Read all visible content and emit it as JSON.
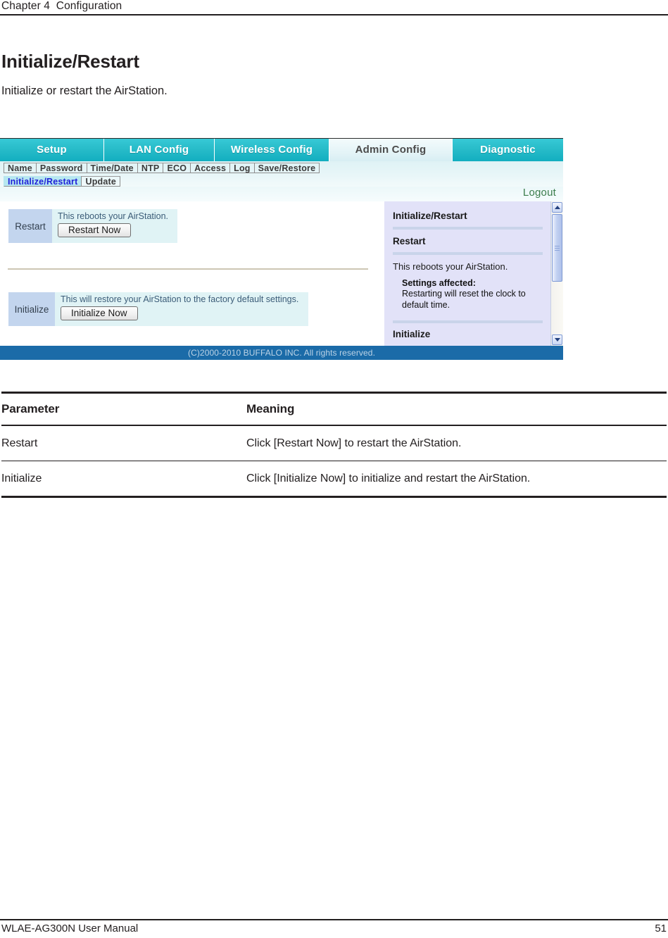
{
  "page": {
    "running_head": "Chapter 4  Configuration",
    "title": "Initialize/Restart",
    "intro": "Initialize or restart the AirStation.",
    "footer_left": "WLAE-AG300N User Manual",
    "footer_page": "51"
  },
  "screenshot": {
    "tabs": [
      {
        "label": "Setup",
        "active": false
      },
      {
        "label": "LAN Config",
        "active": false
      },
      {
        "label": "Wireless Config",
        "active": false
      },
      {
        "label": "Admin Config",
        "active": true
      },
      {
        "label": "Diagnostic",
        "active": false
      }
    ],
    "subnav_row1": [
      {
        "label": "Name",
        "selected": false
      },
      {
        "label": "Password",
        "selected": false
      },
      {
        "label": "Time/Date",
        "selected": false
      },
      {
        "label": "NTP",
        "selected": false
      },
      {
        "label": "ECO",
        "selected": false
      },
      {
        "label": "Access",
        "selected": false
      },
      {
        "label": "Log",
        "selected": false
      },
      {
        "label": "Save/Restore",
        "selected": false
      }
    ],
    "subnav_row2": [
      {
        "label": "Initialize/Restart",
        "selected": true
      },
      {
        "label": "Update",
        "selected": false
      }
    ],
    "logout_label": "Logout",
    "rows": [
      {
        "label": "Restart",
        "description": "This reboots your AirStation.",
        "button": "Restart Now"
      },
      {
        "label": "Initialize",
        "description": "This will restore your AirStation to the factory default settings.",
        "button": "Initialize Now"
      }
    ],
    "help": {
      "heading": "Initialize/Restart",
      "section_restart_title": "Restart",
      "section_restart_text": "This reboots your AirStation.",
      "settings_affected_label": "Settings affected:",
      "settings_affected_line1": "Restarting will reset the clock to",
      "settings_affected_line2": "default time.",
      "section_initialize_title": "Initialize"
    },
    "copyright": "(C)2000-2010 BUFFALO INC. All rights reserved.",
    "colors": {
      "tab_active_bg": "#e4f4f7",
      "tab_bg": "#28bcc9",
      "subnav_selected_text": "#2020d8",
      "row_label_bg": "#c3d5ee",
      "row_bg": "#e0f3f5",
      "help_bg": "#e2e2f8",
      "footer_bg": "#1b6ba8",
      "logout_text": "#3c7d4c"
    }
  },
  "table": {
    "headers": [
      "Parameter",
      "Meaning"
    ],
    "rows": [
      {
        "parameter": "Restart",
        "meaning": "Click [Restart Now] to restart the AirStation."
      },
      {
        "parameter": "Initialize",
        "meaning": "Click [Initialize Now] to initialize and restart the AirStation."
      }
    ]
  }
}
